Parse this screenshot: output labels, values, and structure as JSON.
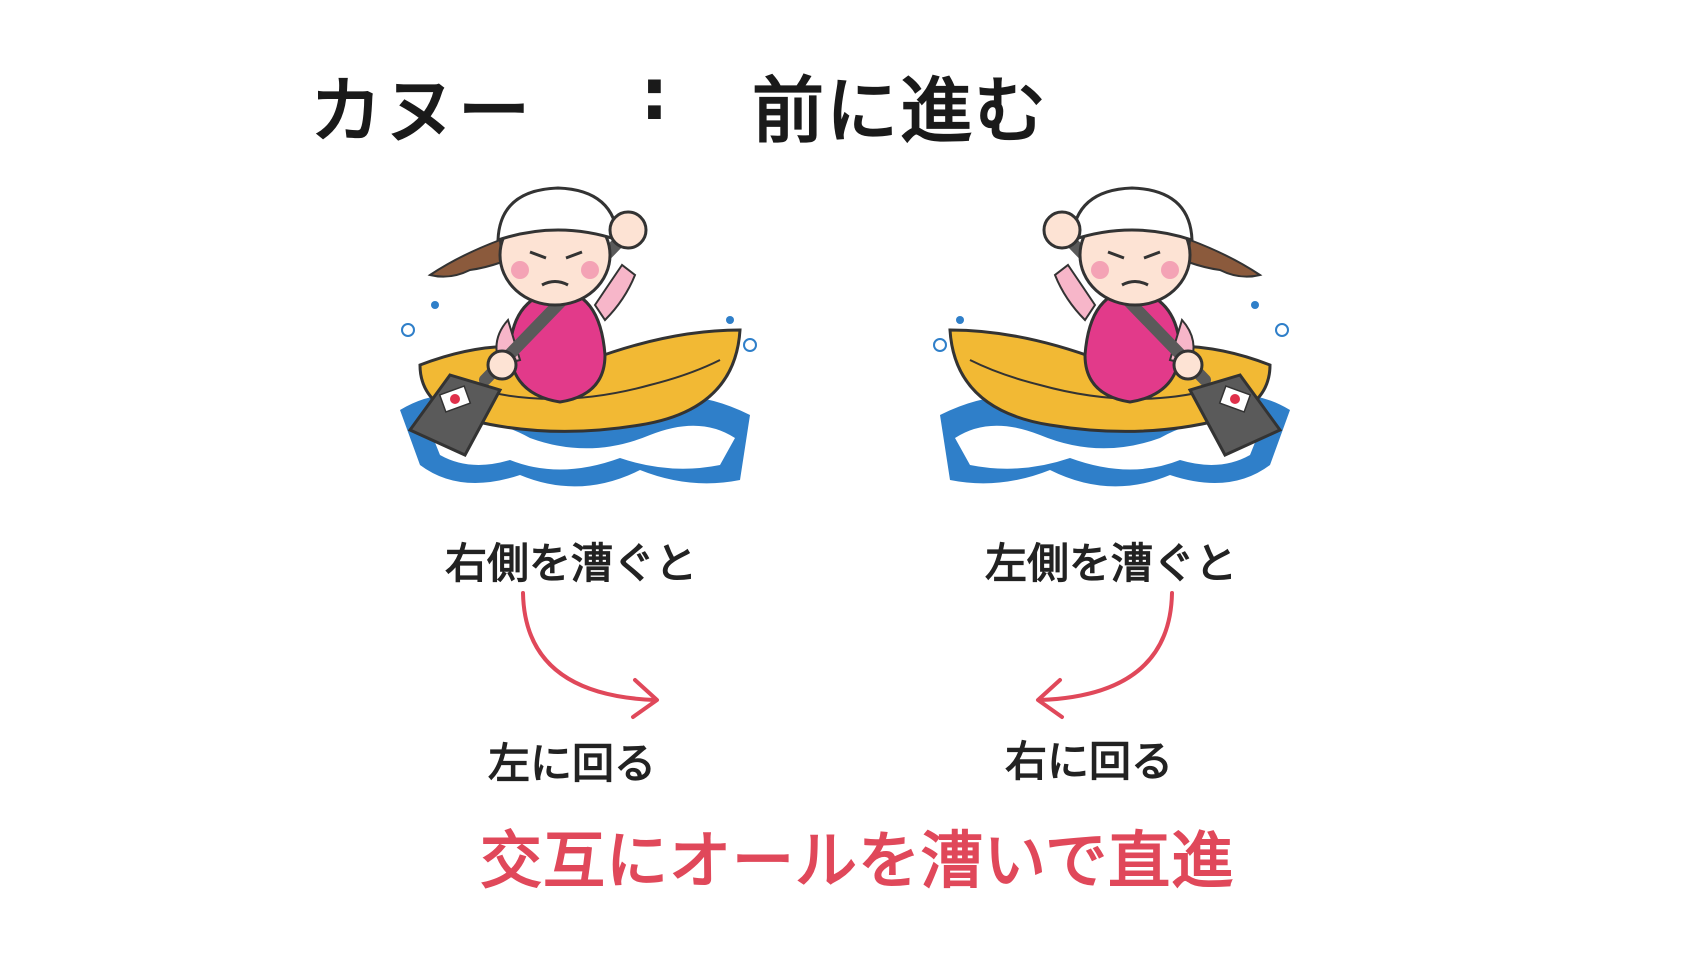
{
  "title": {
    "left": "カヌー",
    "colon": ":",
    "right": "前に進む"
  },
  "figures": {
    "left": {
      "stroke_label": "右側を漕ぐと",
      "turn_label": "左に回る"
    },
    "right": {
      "stroke_label": "左側を漕ぐと",
      "turn_label": "右に回る"
    }
  },
  "summary": "交互にオールを漕いで直進",
  "colors": {
    "accent": "#e0485a",
    "boat": "#f2b934",
    "suit": "#e23a8a",
    "water": "#2f7fc9",
    "paddle": "#5a5a5a"
  }
}
